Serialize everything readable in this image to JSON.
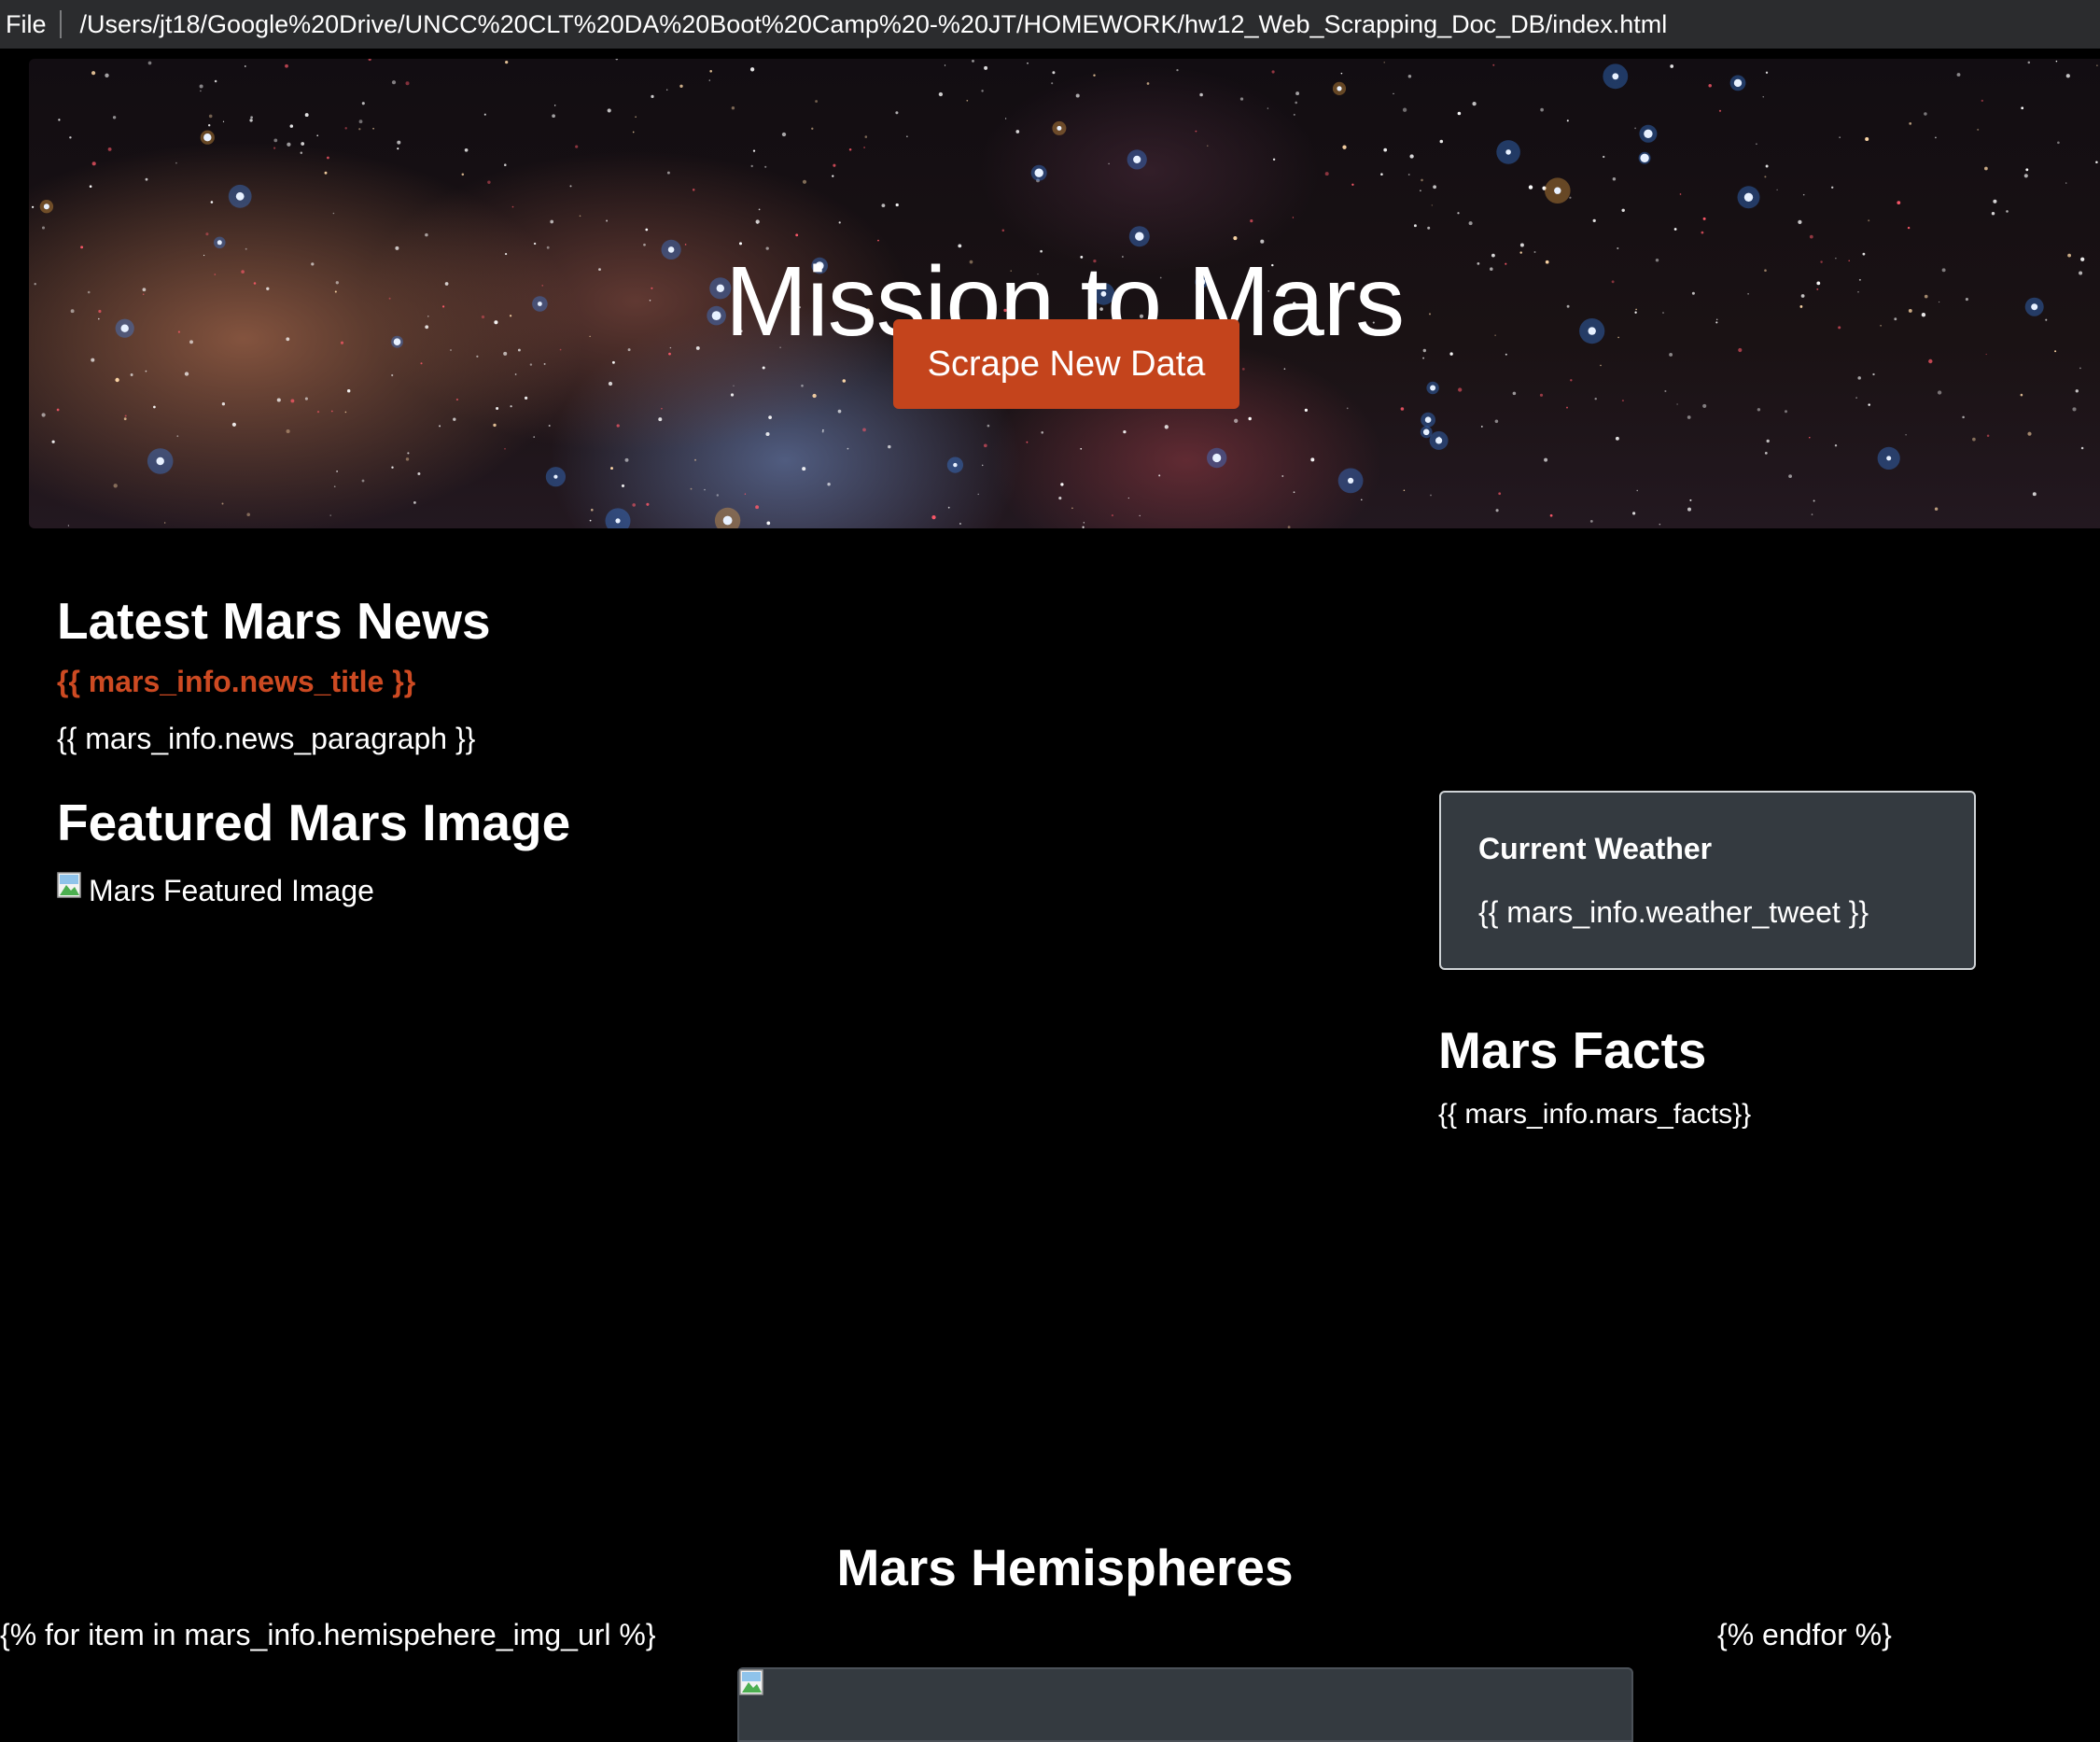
{
  "browser": {
    "file_label": "File",
    "url": "/Users/jt18/Google%20Drive/UNCC%20CLT%20DA%20Boot%20Camp%20-%20JT/HOMEWORK/hw12_Web_Scrapping_Doc_DB/index.html"
  },
  "hero": {
    "title": "Mission to Mars",
    "button_label": "Scrape New Data"
  },
  "news": {
    "heading": "Latest Mars News",
    "title": "{{ mars_info.news_title }}",
    "paragraph": "{{ mars_info.news_paragraph }}"
  },
  "featured": {
    "heading": "Featured Mars Image",
    "image_alt": "Mars Featured Image"
  },
  "weather": {
    "title": "Current Weather",
    "text": "{{ mars_info.weather_tweet }}"
  },
  "facts": {
    "heading": "Mars Facts",
    "text": "{{ mars_info.mars_facts}}"
  },
  "hemispheres": {
    "heading": "Mars Hemispheres",
    "for_text": "{% for item in mars_info.hemispehere_img_url %}",
    "endfor_text": "{% endfor %}"
  },
  "colors": {
    "accent": "#c4441c",
    "card_bg": "#343a40",
    "page_bg": "#000000"
  }
}
